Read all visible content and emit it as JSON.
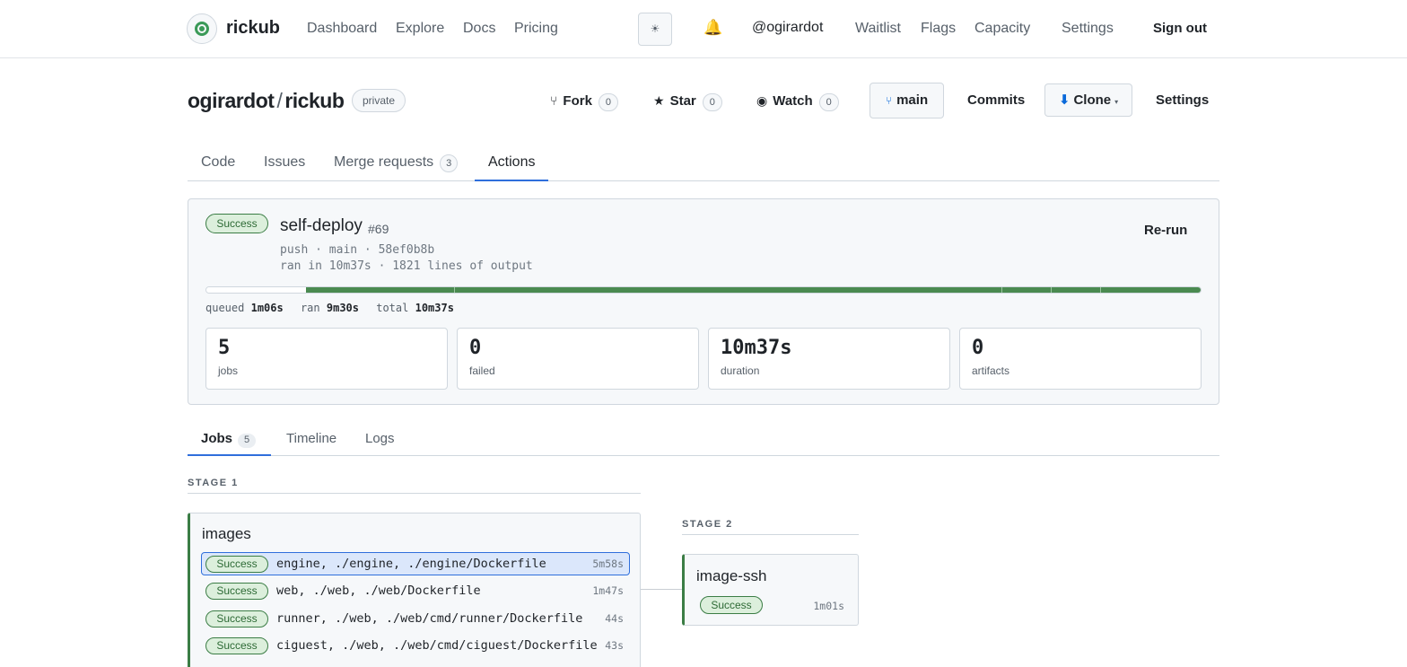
{
  "app": {
    "brand": "rickub",
    "nav": [
      "Dashboard",
      "Explore",
      "Docs",
      "Pricing"
    ],
    "theme_icon": "☀",
    "bell_icon": "🔔",
    "user": "@ogirardot",
    "user_nav": [
      "Waitlist",
      "Flags",
      "Capacity",
      "Settings"
    ],
    "sign_out": "Sign out"
  },
  "repo": {
    "owner": "ogirardot",
    "separator": "/",
    "name": "rickub",
    "visibility": "private",
    "fork_label": "Fork",
    "fork_count": "0",
    "star_label": "Star",
    "star_count": "0",
    "watch_label": "Watch",
    "watch_count": "0",
    "branch": "main",
    "commits": "Commits",
    "clone": "Clone",
    "settings": "Settings",
    "icons": {
      "fork": "⑂",
      "star": "★",
      "watch": "◉",
      "branch": "⑂",
      "clone": "⬇",
      "caret": "▾"
    }
  },
  "repo_tabs": {
    "code": "Code",
    "issues": "Issues",
    "merge_requests": "Merge requests",
    "merge_requests_count": "3",
    "actions": "Actions",
    "active": "Actions"
  },
  "run": {
    "status": "Success",
    "name": "self-deploy",
    "number": "#69",
    "trigger_line": "push · main · 58ef0b8b",
    "summary_line": "ran in 10m37s · 1821 lines of output",
    "rerun": "Re-run",
    "progress": {
      "queued_fraction": 0.1,
      "ran_fraction": 0.9
    },
    "timing": {
      "queued_label": "queued",
      "queued": "1m06s",
      "ran_label": "ran",
      "ran": "9m30s",
      "total_label": "total",
      "total": "10m37s"
    },
    "stats": [
      {
        "value": "5",
        "label": "jobs"
      },
      {
        "value": "0",
        "label": "failed"
      },
      {
        "value": "10m37s",
        "label": "duration"
      },
      {
        "value": "0",
        "label": "artifacts"
      }
    ]
  },
  "job_tabs": {
    "jobs": "Jobs",
    "jobs_count": "5",
    "timeline": "Timeline",
    "logs": "Logs",
    "active": "Jobs"
  },
  "stages": [
    {
      "label": "STAGE 1",
      "group": "images",
      "jobs": [
        {
          "status": "Success",
          "name": "engine, ./engine, ./engine/Dockerfile",
          "duration": "5m58s",
          "selected": true
        },
        {
          "status": "Success",
          "name": "web, ./web, ./web/Dockerfile",
          "duration": "1m47s",
          "selected": false
        },
        {
          "status": "Success",
          "name": "runner, ./web, ./web/cmd/runner/Dockerfile",
          "duration": "44s",
          "selected": false
        },
        {
          "status": "Success",
          "name": "ciguest, ./web, ./web/cmd/ciguest/Dockerfile",
          "duration": "43s",
          "selected": false
        }
      ]
    },
    {
      "label": "STAGE 2",
      "group": "image-ssh",
      "jobs": [
        {
          "status": "Success",
          "name": "",
          "duration": "1m01s",
          "selected": false
        }
      ]
    }
  ],
  "colors": {
    "success": "#3b7d45",
    "success_bg": "#dcefdc",
    "accent": "#2f6fdc",
    "progress": "#4a8a50"
  }
}
